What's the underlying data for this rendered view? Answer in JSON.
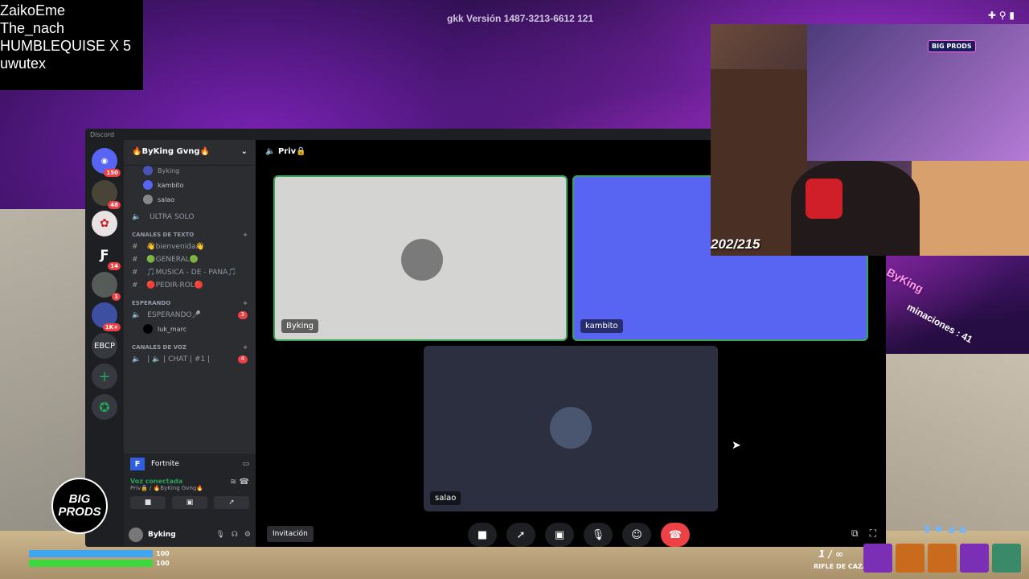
{
  "overlay": {
    "names": [
      "ZaikoEme",
      "The_nach",
      "HUMBLEQUISE X 5",
      "uwutex"
    ],
    "version": "gkk  Versión 1487-3213-6612 121",
    "counter": "202/215",
    "sign": "BIG PRODS",
    "eliminations_label": "ByKing",
    "eliminations_count": "minaciones : 41",
    "logo_line1": "BIG",
    "logo_line2": "PRODS"
  },
  "discord": {
    "window_title": "Discord",
    "guild_name": "🔥ByKing Gvng🔥",
    "top_users": [
      "Byking",
      "kambito",
      "salao"
    ],
    "voice_top": "ULTRA SOLO",
    "categories": {
      "text": "CANALES DE TEXTO",
      "waiting": "ESPERANDO",
      "voice": "CANALES DE VOZ"
    },
    "text_channels": [
      "👋bienvenida👋",
      "🟢GENERAL🟢",
      "🎵MUSICA - DE - PANA🎵",
      "🔴PEDIR-ROL🔴"
    ],
    "waiting_channel": "ESPERANDO🎤",
    "waiting_count": "3",
    "waiting_user": "luk_marc",
    "voice_channel": "| 🔈 | CHAT | #1 |",
    "voice_count": "4",
    "servers": [
      {
        "label": "",
        "badge": "150"
      },
      {
        "label": "",
        "badge": "48"
      },
      {
        "label": "",
        "badge": ""
      },
      {
        "label": "",
        "badge": "14"
      },
      {
        "label": "",
        "badge": "1"
      },
      {
        "label": "",
        "badge": "1K+"
      },
      {
        "label": "EBCP",
        "badge": ""
      }
    ],
    "activity": "Fortnite",
    "voice_status": "Voz conectada",
    "voice_location": "Priv🔒 / 🔥ByKing Gvng🔥",
    "username": "Byking",
    "call_title": "Priv🔒",
    "tiles": {
      "a": "Byking",
      "b": "kambito",
      "c": "salao"
    },
    "invite": "Invitación"
  },
  "hud": {
    "health": "100",
    "shield": "100",
    "ammo": "1 / ∞",
    "weapon": "RIFLE DE CAZA",
    "health_level": 1.0,
    "shield_level": 1.0
  },
  "colors": {
    "discord_blurple": "#5865f2",
    "danger": "#ed4245",
    "online": "#23a55a"
  }
}
